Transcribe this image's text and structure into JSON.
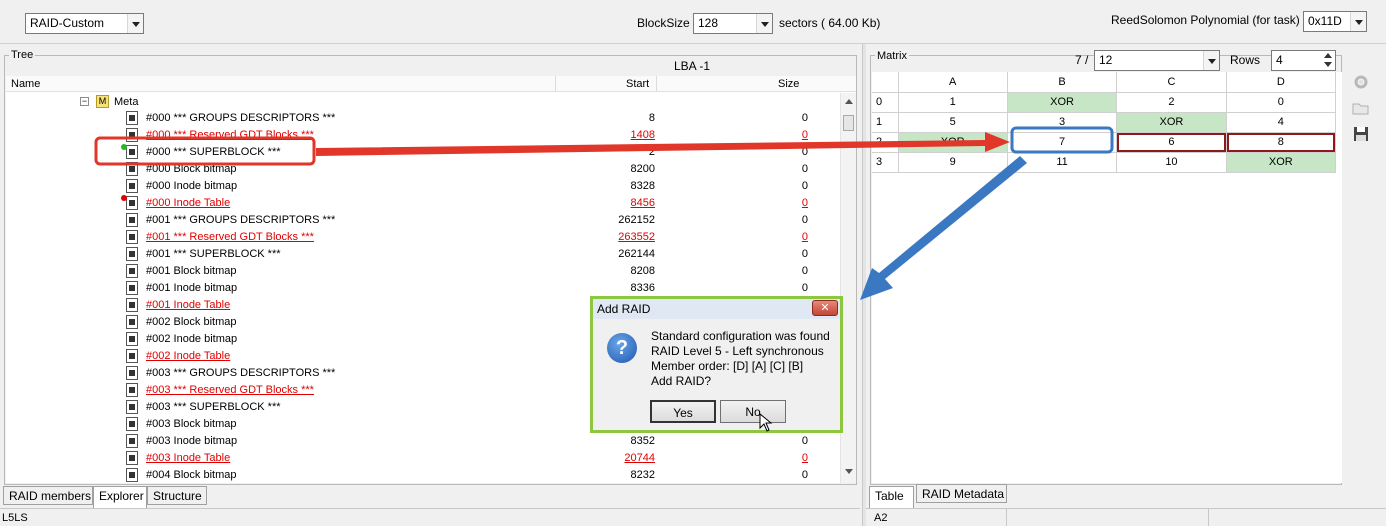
{
  "toolbar": {
    "raid_type": "RAID-Custom",
    "blocksize_label": "BlockSize",
    "blocksize_value": "128",
    "sectors_label": "sectors ( 64.00 Kb)",
    "rs_label": "ReedSolomon Polynomial (for task)",
    "rs_value": "0x11D"
  },
  "tree": {
    "group_title": "Tree",
    "lba_label": "LBA  -1",
    "col_name": "Name",
    "col_start": "Start",
    "col_size": "Size",
    "meta_badge": "M",
    "meta_label": "Meta",
    "rows": [
      {
        "name": "#000   *** GROUPS DESCRIPTORS ***",
        "start": "8",
        "size": "0",
        "red": false,
        "dot": ""
      },
      {
        "name": "#000   *** Reserved GDT Blocks ***",
        "start": "1408",
        "size": "0",
        "red": true,
        "dot": ""
      },
      {
        "name": "#000   *** SUPERBLOCK ***",
        "start": "2",
        "size": "0",
        "red": false,
        "dot": "#2bb52b"
      },
      {
        "name": "#000  Block bitmap",
        "start": "8200",
        "size": "0",
        "red": false,
        "dot": ""
      },
      {
        "name": "#000  Inode bitmap",
        "start": "8328",
        "size": "0",
        "red": false,
        "dot": ""
      },
      {
        "name": "#000  Inode Table",
        "start": "8456",
        "size": "0",
        "red": true,
        "dot": "#e00000"
      },
      {
        "name": "#001   *** GROUPS DESCRIPTORS ***",
        "start": "262152",
        "size": "0",
        "red": false,
        "dot": ""
      },
      {
        "name": "#001   *** Reserved GDT Blocks ***",
        "start": "263552",
        "size": "0",
        "red": true,
        "dot": ""
      },
      {
        "name": "#001   *** SUPERBLOCK ***",
        "start": "262144",
        "size": "0",
        "red": false,
        "dot": ""
      },
      {
        "name": "#001  Block bitmap",
        "start": "8208",
        "size": "0",
        "red": false,
        "dot": ""
      },
      {
        "name": "#001  Inode bitmap",
        "start": "8336",
        "size": "0",
        "red": false,
        "dot": ""
      },
      {
        "name": "#001  Inode Table",
        "start": "",
        "size": "",
        "red": true,
        "dot": ""
      },
      {
        "name": "#002  Block bitmap",
        "start": "",
        "size": "",
        "red": false,
        "dot": ""
      },
      {
        "name": "#002  Inode bitmap",
        "start": "",
        "size": "",
        "red": false,
        "dot": ""
      },
      {
        "name": "#002  Inode Table",
        "start": "",
        "size": "",
        "red": true,
        "dot": ""
      },
      {
        "name": "#003   *** GROUPS DESCRIPTORS ***",
        "start": "",
        "size": "",
        "red": false,
        "dot": ""
      },
      {
        "name": "#003   *** Reserved GDT Blocks ***",
        "start": "",
        "size": "",
        "red": true,
        "dot": ""
      },
      {
        "name": "#003   *** SUPERBLOCK ***",
        "start": "",
        "size": "",
        "red": false,
        "dot": ""
      },
      {
        "name": "#003  Block bitmap",
        "start": "",
        "size": "",
        "red": false,
        "dot": ""
      },
      {
        "name": "#003  Inode bitmap",
        "start": "8352",
        "size": "0",
        "red": false,
        "dot": ""
      },
      {
        "name": "#003  Inode Table",
        "start": "20744",
        "size": "0",
        "red": true,
        "dot": ""
      },
      {
        "name": "#004  Block bitmap",
        "start": "8232",
        "size": "0",
        "red": false,
        "dot": ""
      }
    ]
  },
  "left_tabs": [
    "RAID members",
    "Explorer",
    "Structure"
  ],
  "left_status": "L5LS",
  "matrix": {
    "group_title": "Matrix",
    "page_label": "7 /",
    "page_value": "12",
    "rows_label": "Rows",
    "rows_value": "4",
    "columns": [
      "A",
      "B",
      "C",
      "D"
    ],
    "rows": [
      {
        "label": "0",
        "cells": [
          "1",
          "XOR",
          "2",
          "0"
        ]
      },
      {
        "label": "1",
        "cells": [
          "5",
          "3",
          "XOR",
          "4"
        ]
      },
      {
        "label": "2",
        "cells": [
          "XOR",
          "7",
          "6",
          "8"
        ]
      },
      {
        "label": "3",
        "cells": [
          "9",
          "11",
          "10",
          "XOR"
        ]
      }
    ]
  },
  "right_tabs": [
    "Table",
    "RAID Metadata"
  ],
  "right_status": "A2",
  "dialog": {
    "title": "Add RAID",
    "line1": "Standard configuration was found",
    "line2": "RAID Level 5 - Left synchronous",
    "line3": "Member order: [D] [A] [C] [B]",
    "line4": "Add RAID?",
    "yes": "Yes",
    "no": "No"
  },
  "colors": {
    "xor_fill": "#c6e6c6",
    "red_arrow": "#e0372a",
    "blue_arrow": "#3a78c2",
    "dialog_border": "#8dc63f"
  }
}
